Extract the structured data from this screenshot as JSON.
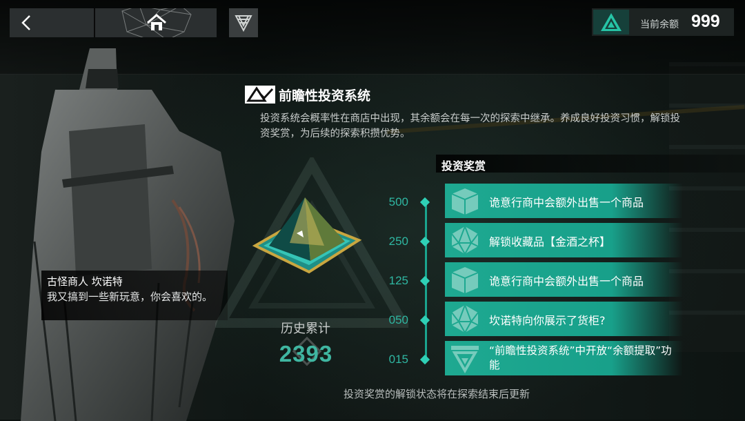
{
  "topbar": {
    "back_icon": "chevron-left-icon",
    "home_icon": "home-icon",
    "menu_icon": "emblem-menu-icon",
    "balance_label": "当前余额",
    "balance_value": "999"
  },
  "merchant": {
    "name": "古怪商人 坎诺特",
    "dialogue": "我又搞到一些新玩意，你会喜欢的。"
  },
  "system": {
    "title": "前瞻性投资系统",
    "description": "投资系统会概率性在商店中出现，其余额会在每一次的探索中继承。养成良好投资习惯，解锁投资奖赏，为后续的探索积攒优势。"
  },
  "history": {
    "label": "历史累计",
    "value": "2393"
  },
  "rewards": {
    "heading": "投资奖赏",
    "items": [
      {
        "tier": "500",
        "text": "诡意行商中会额外出售一个商品",
        "icon": "box-icon"
      },
      {
        "tier": "250",
        "text": "解锁收藏品【金酒之杯】",
        "icon": "d20-dice-icon"
      },
      {
        "tier": "125",
        "text": "诡意行商中会额外出售一个商品",
        "icon": "box-icon"
      },
      {
        "tier": "050",
        "text": "坎诺特向你展示了货柜?",
        "icon": "d20-dice-icon"
      },
      {
        "tier": "015",
        "text": "“前瞻性投资系统”中开放“余额提取”功能",
        "icon": "investment-emblem-icon"
      }
    ]
  },
  "footer": "投资奖赏的解锁状态将在探索结束后更新",
  "colors": {
    "accent": "#1ea991",
    "teal_text": "#3fb6a1"
  }
}
